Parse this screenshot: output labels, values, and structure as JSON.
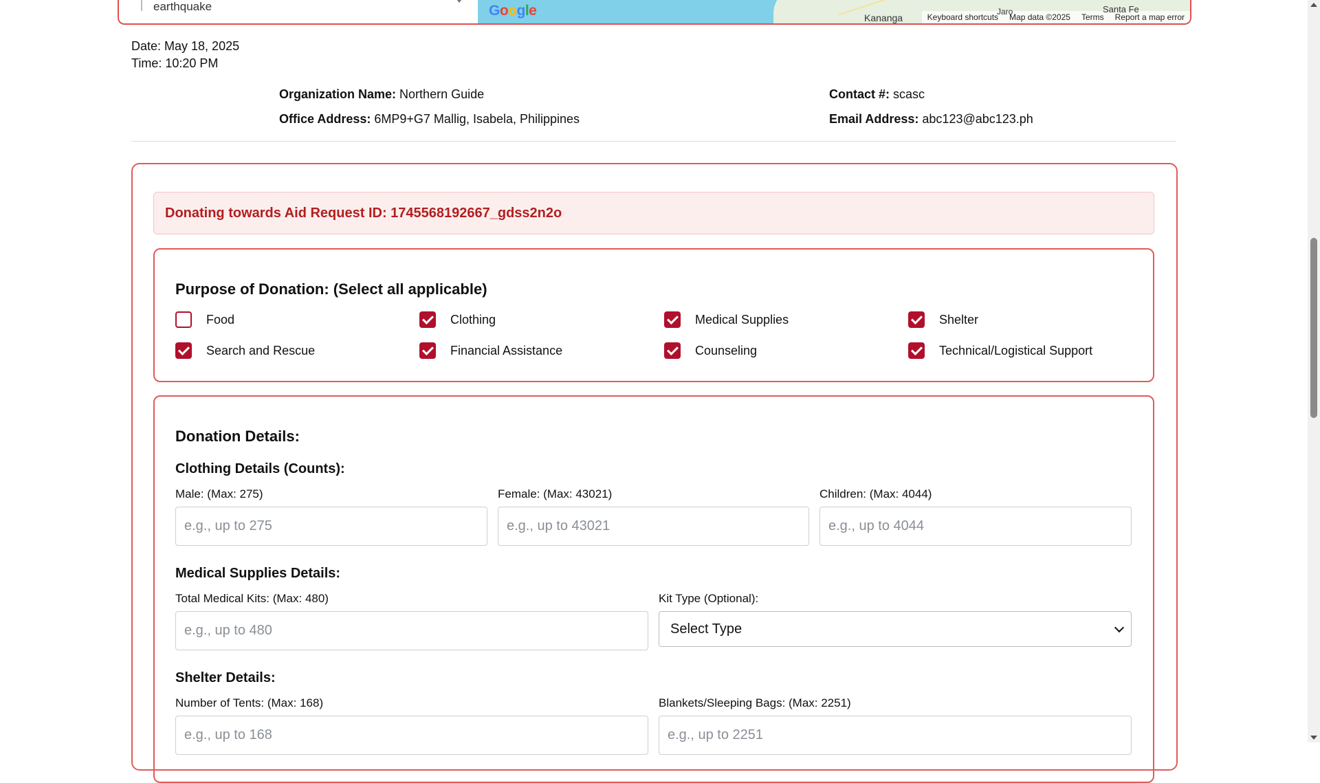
{
  "map": {
    "search_text": "earthquake",
    "google_logo": "Google",
    "cities": {
      "kananga": "Kananga",
      "jaro": "Jaro",
      "santa_fe": "Santa Fe"
    },
    "footer": {
      "shortcuts": "Keyboard shortcuts",
      "data": "Map data ©2025",
      "terms": "Terms",
      "report": "Report a map error"
    }
  },
  "meta": {
    "date": "Date: May 18, 2025",
    "time": "Time: 10:20 PM"
  },
  "org": {
    "name_label": "Organization Name:",
    "name": "Northern Guide",
    "address_label": "Office Address:",
    "address": "6MP9+G7 Mallig, Isabela, Philippines",
    "contact_label": "Contact #:",
    "contact": "scasc",
    "email_label": "Email Address:",
    "email": "abc123@abc123.ph"
  },
  "aid_request": {
    "text": "Donating towards Aid Request ID: 1745568192667_gdss2n2o"
  },
  "purpose": {
    "title": "Purpose of Donation: (Select all applicable)",
    "options": [
      {
        "label": "Food",
        "checked": false
      },
      {
        "label": "Clothing",
        "checked": true
      },
      {
        "label": "Medical Supplies",
        "checked": true
      },
      {
        "label": "Shelter",
        "checked": true
      },
      {
        "label": "Search and Rescue",
        "checked": true
      },
      {
        "label": "Financial Assistance",
        "checked": true
      },
      {
        "label": "Counseling",
        "checked": true
      },
      {
        "label": "Technical/Logistical Support",
        "checked": true
      }
    ]
  },
  "details": {
    "title": "Donation Details:",
    "clothing": {
      "title": "Clothing Details (Counts):",
      "male_label": "Male: (Max: 275)",
      "male_placeholder": "e.g., up to 275",
      "female_label": "Female: (Max: 43021)",
      "female_placeholder": "e.g., up to 43021",
      "children_label": "Children: (Max: 4044)",
      "children_placeholder": "e.g., up to 4044"
    },
    "medical": {
      "title": "Medical Supplies Details:",
      "kits_label": "Total Medical Kits: (Max: 480)",
      "kits_placeholder": "e.g., up to 480",
      "kit_type_label": "Kit Type (Optional):",
      "kit_type_value": "Select Type"
    },
    "shelter": {
      "title": "Shelter Details:",
      "tents_label": "Number of Tents: (Max: 168)",
      "tents_placeholder": "e.g., up to 168",
      "blankets_label": "Blankets/Sleeping Bags: (Max: 2251)",
      "blankets_placeholder": "e.g., up to 2251"
    }
  },
  "colors": {
    "accent": "#b0102c",
    "border": "#e25a5a",
    "banner_bg": "#fdeeee",
    "banner_text": "#b21e1e"
  }
}
